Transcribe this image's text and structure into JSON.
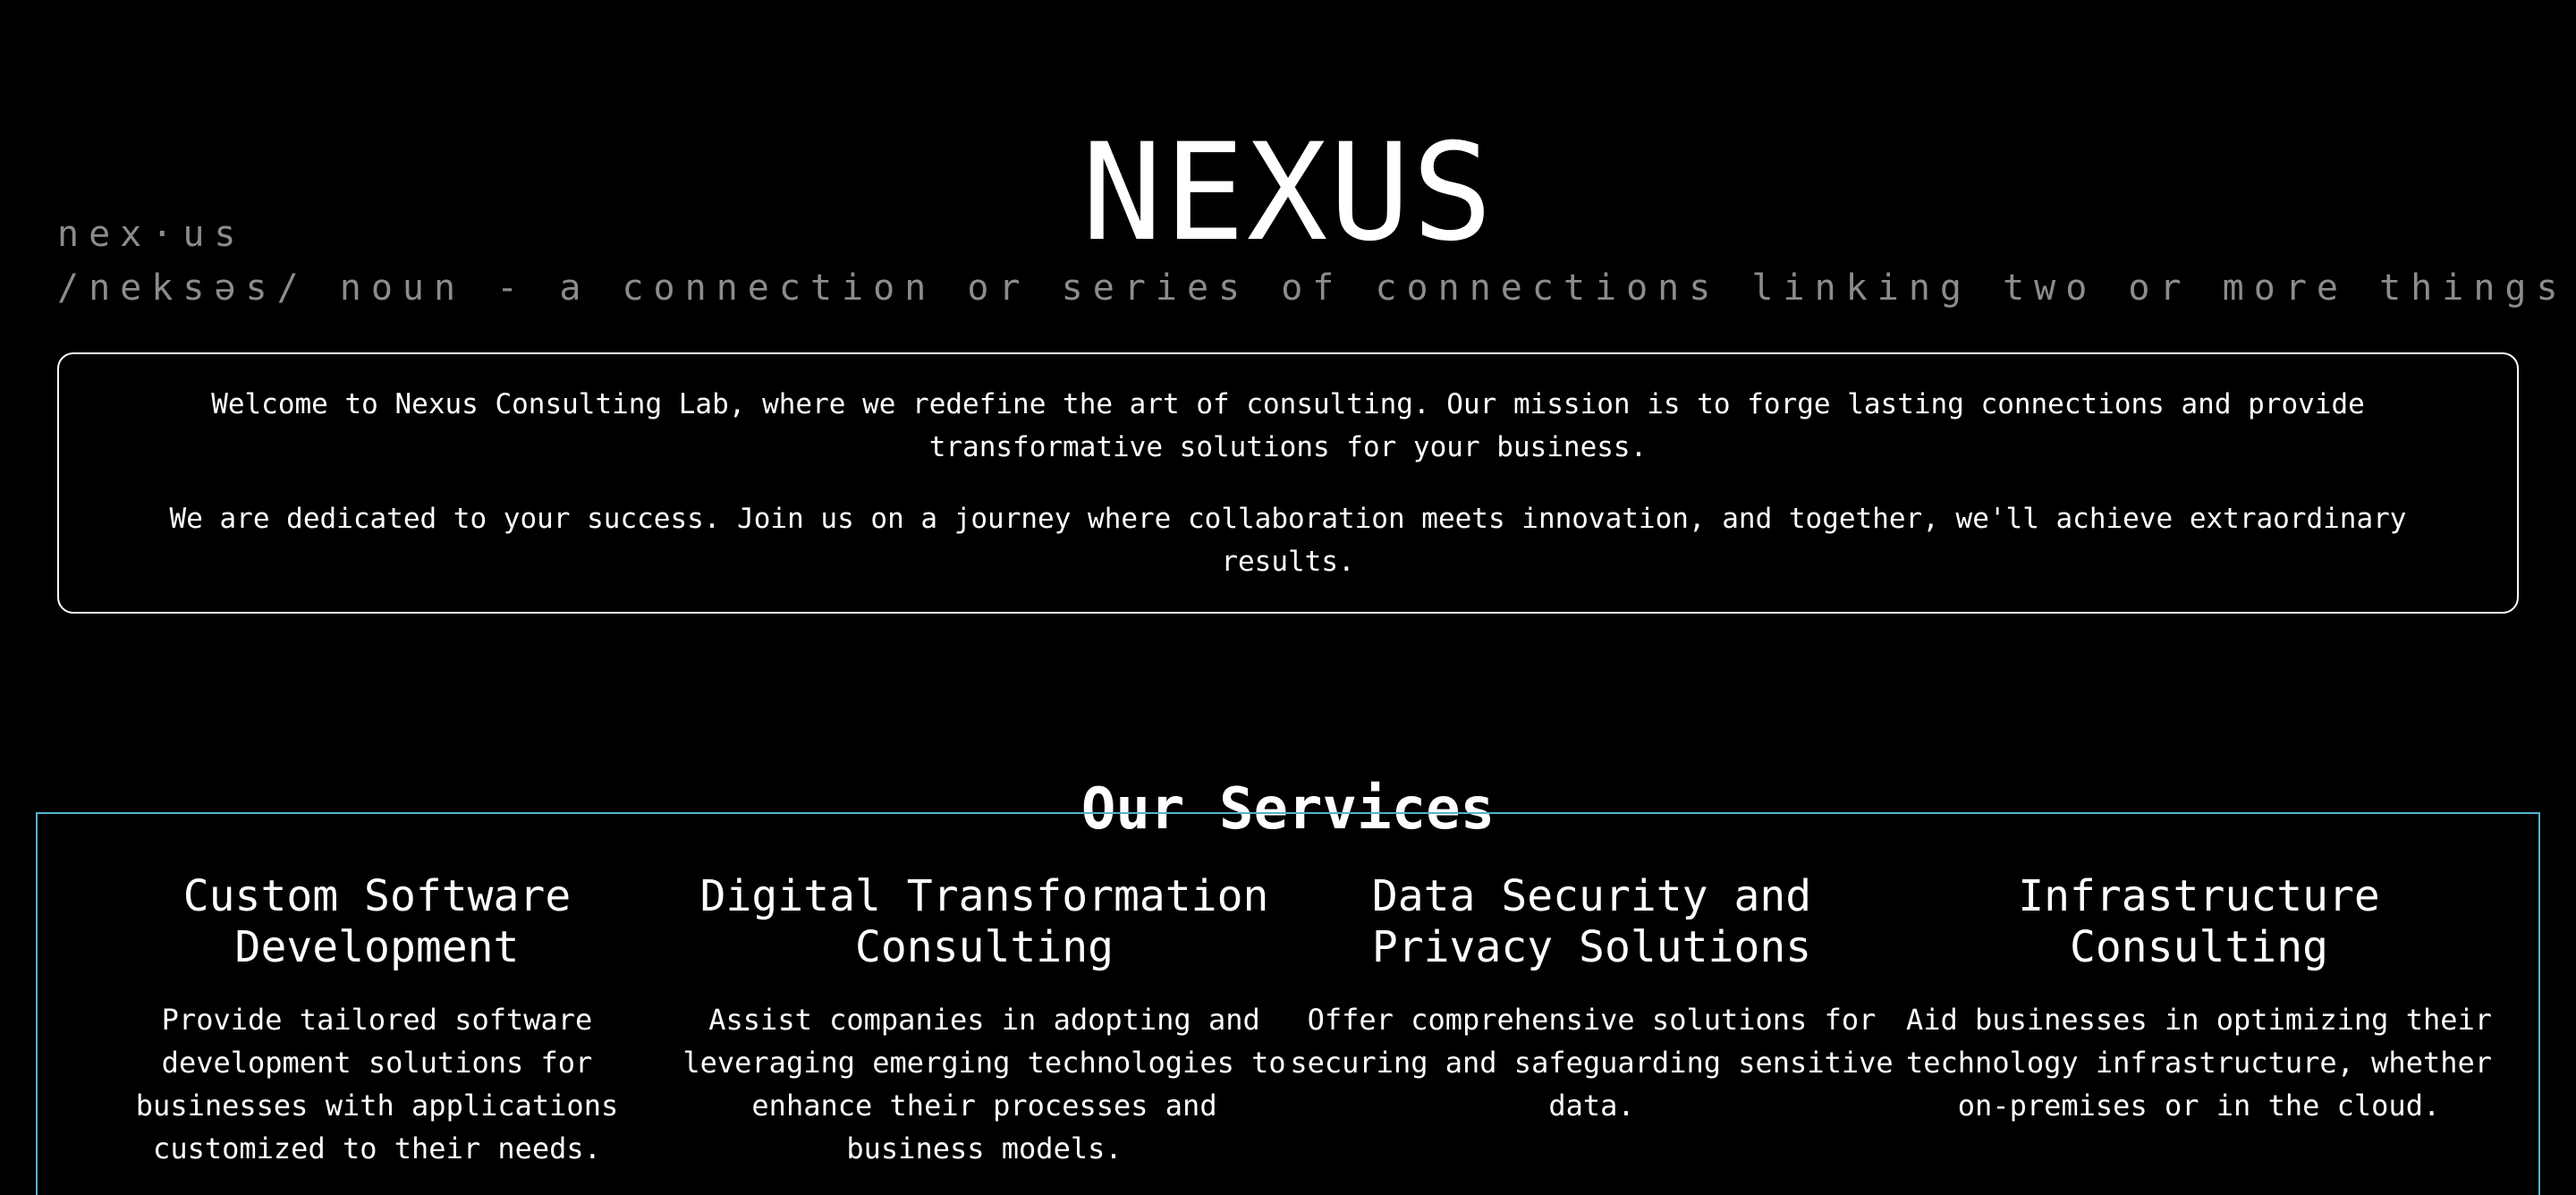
{
  "brand": {
    "title": "NEXUS",
    "definition_word": "nex·us",
    "definition_text": "/neksəs/ noun - a connection or series of connections linking two or more things."
  },
  "intro": {
    "paragraph_1": "Welcome to Nexus Consulting Lab, where we redefine the art of consulting. Our mission is to forge lasting connections and provide transformative solutions for your business.",
    "paragraph_2": "We are dedicated to your success. Join us on a journey where collaboration meets innovation, and together, we'll achieve extraordinary results."
  },
  "services": {
    "heading": "Our Services",
    "items": [
      {
        "title": "Custom Software Development",
        "description": "Provide tailored software development solutions for businesses with applications customized to their needs."
      },
      {
        "title": "Digital Transformation Consulting",
        "description": "Assist companies in adopting and leveraging emerging technologies to enhance their processes and business models."
      },
      {
        "title": "Data Security and Privacy Solutions",
        "description": "Offer comprehensive solutions for securing and safeguarding sensitive data."
      },
      {
        "title": "Infrastructure Consulting",
        "description": "Aid businesses in optimizing their technology infrastructure, whether on-premises or in the cloud."
      }
    ]
  },
  "colors": {
    "background": "#000000",
    "text": "#ffffff",
    "muted_text": "#8c8c8c",
    "services_border": "#4fb4c8"
  }
}
